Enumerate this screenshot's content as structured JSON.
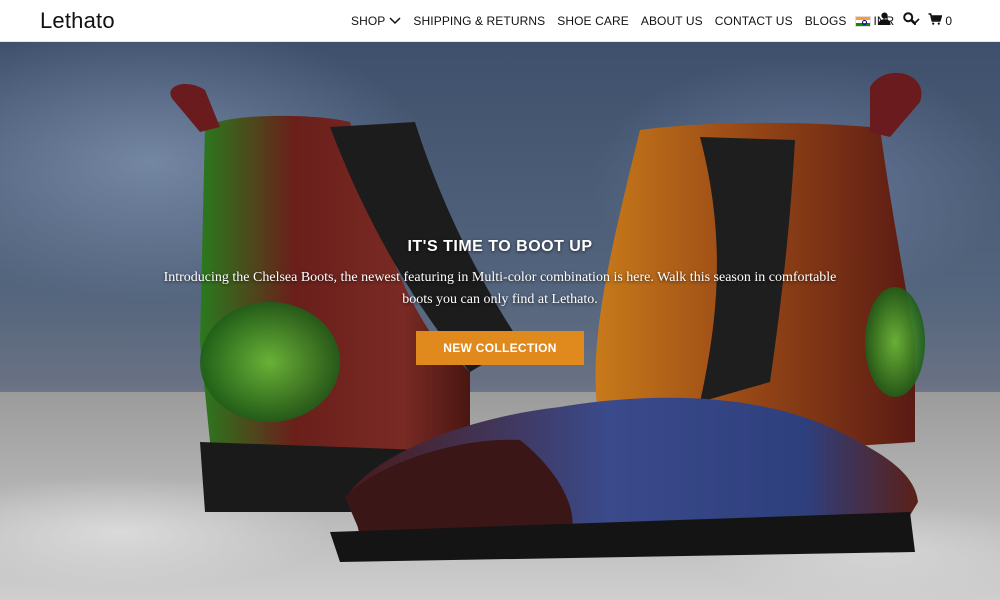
{
  "brand": {
    "name": "Lethato"
  },
  "nav": {
    "items": [
      {
        "label": "SHOP",
        "has_dropdown": true
      },
      {
        "label": "SHIPPING & RETURNS"
      },
      {
        "label": "SHOE CARE"
      },
      {
        "label": "ABOUT US"
      },
      {
        "label": "CONTACT US"
      },
      {
        "label": "BLOGS"
      }
    ],
    "currency": {
      "code": "INR",
      "flag": "india-flag-icon"
    }
  },
  "actions": {
    "account_icon": "user-icon",
    "search_icon": "search-icon",
    "cart_icon": "cart-icon",
    "cart_count": "0"
  },
  "hero": {
    "title": "IT'S TIME TO BOOT UP",
    "text": "Introducing the Chelsea Boots, the newest featuring in Multi-color combination is here. Walk this season in comfortable boots you can only find at Lethato.",
    "cta_label": "NEW COLLECTION",
    "cta_color": "#e08a1e"
  }
}
